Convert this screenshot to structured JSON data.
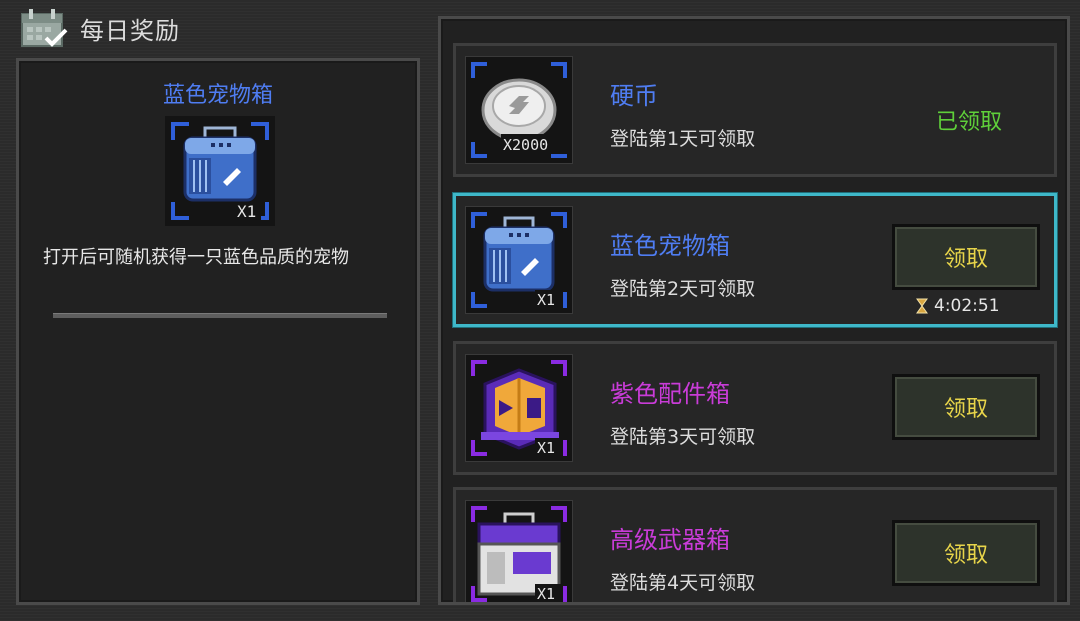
{
  "header": {
    "title": "每日奖励",
    "icon": "calendar-check-icon"
  },
  "detail": {
    "name": "蓝色宠物箱",
    "name_color": "#4f7df2",
    "icon": "blue-pet-crate-icon",
    "quantity": "X1",
    "description": "打开后可随机获得一只蓝色品质的宠物"
  },
  "rewards": [
    {
      "name": "硬币",
      "name_color": "#4f7df2",
      "requirement": "登陆第1天可领取",
      "icon": "silver-coin-icon",
      "quantity": "X2000",
      "status": "已领取"
    },
    {
      "name": "蓝色宠物箱",
      "name_color": "#4f7df2",
      "requirement": "登陆第2天可领取",
      "icon": "blue-pet-crate-icon",
      "quantity": "X1",
      "button": "领取",
      "timer": "4:02:51",
      "selected": true
    },
    {
      "name": "紫色配件箱",
      "name_color": "#c93cd8",
      "requirement": "登陆第3天可领取",
      "icon": "purple-parts-box-icon",
      "quantity": "X1",
      "button": "领取"
    },
    {
      "name": "高级武器箱",
      "name_color": "#c93cd8",
      "requirement": "登陆第4天可领取",
      "icon": "advanced-weapon-case-icon",
      "quantity": "X1",
      "button": "领取"
    }
  ],
  "colors": {
    "claimed": "#5fd03a",
    "button_text": "#e8d54a",
    "selected_border": "#3fb8c9"
  }
}
